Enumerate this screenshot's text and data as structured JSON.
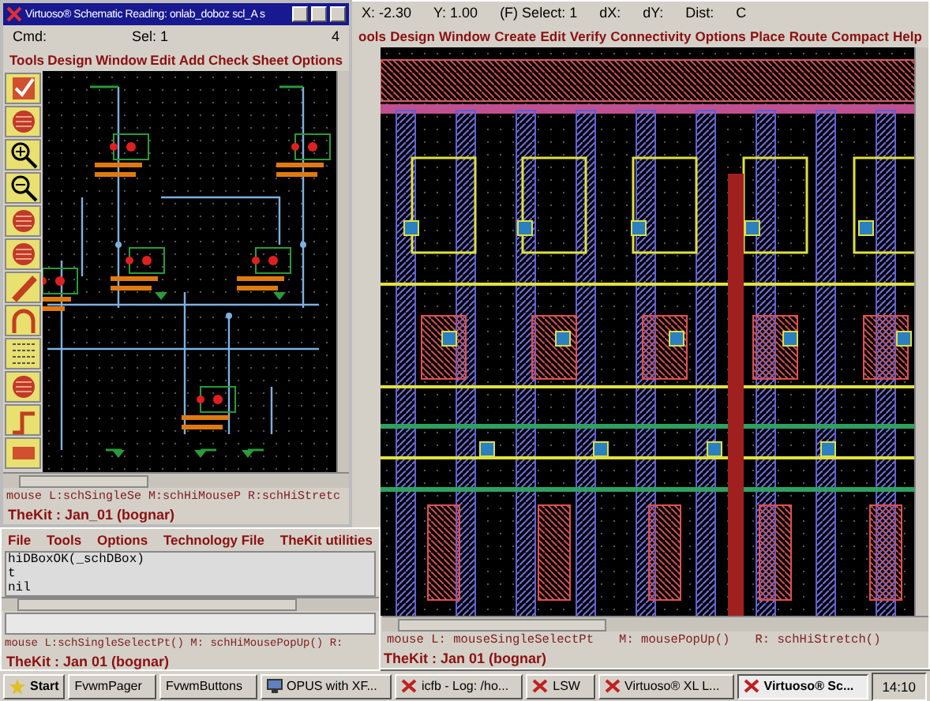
{
  "schematic_window": {
    "title": "Virtuoso® Schematic Reading: onlab_doboz scl_A s",
    "cmd": "Cmd:",
    "sel": "Sel: 1",
    "count": "4",
    "menu": [
      "Tools",
      "Design",
      "Window",
      "Edit",
      "Add",
      "Check",
      "Sheet",
      "Options"
    ],
    "mouse": "mouse L:schSingleSe M:schHiMouseP R:schHiStretc",
    "user": "TheKit : Jan_01  (bognar)"
  },
  "layout_window": {
    "status": [
      "X: -2.30",
      "Y: 1.00",
      "(F) Select: 1",
      "dX:",
      "dY:",
      "Dist:",
      "C"
    ],
    "menu": [
      "ools",
      "Design",
      "Window",
      "Create",
      "Edit",
      "Verify",
      "Connectivity",
      "Options",
      "Place",
      "Route",
      "Compact",
      "Help"
    ],
    "mouse": [
      "mouse L: mouseSingleSelectPt",
      "M: mousePopUp()",
      "R: schHiStretch()"
    ],
    "user": "TheKit : Jan 01  (bognar)"
  },
  "ciw_window": {
    "menu": [
      "File",
      "Tools",
      "Options",
      "Technology File",
      "TheKit utilities"
    ],
    "log": [
      "hiDBoxOK(_schDBox)",
      "t",
      "nil"
    ],
    "mouse": "mouse L:schSingleSelectPt() M: schHiMousePopUp()  R:",
    "user": "TheKit : Jan 01  (bognar)"
  },
  "taskbar": {
    "start": "Start",
    "clock": "14:10",
    "items": [
      {
        "label": "FvwmPager",
        "kind": "plain",
        "selected": false
      },
      {
        "label": "FvwmButtons",
        "kind": "plain",
        "selected": false
      },
      {
        "label": "OPUS with XF...",
        "kind": "app",
        "selected": false
      },
      {
        "label": "icfb - Log: /ho...",
        "kind": "cadence",
        "selected": false
      },
      {
        "label": "LSW",
        "kind": "cadence",
        "selected": false
      },
      {
        "label": "Virtuoso® XL L...",
        "kind": "cadence",
        "selected": false
      },
      {
        "label": "Virtuoso® Sc...",
        "kind": "cadence",
        "selected": true
      }
    ]
  }
}
